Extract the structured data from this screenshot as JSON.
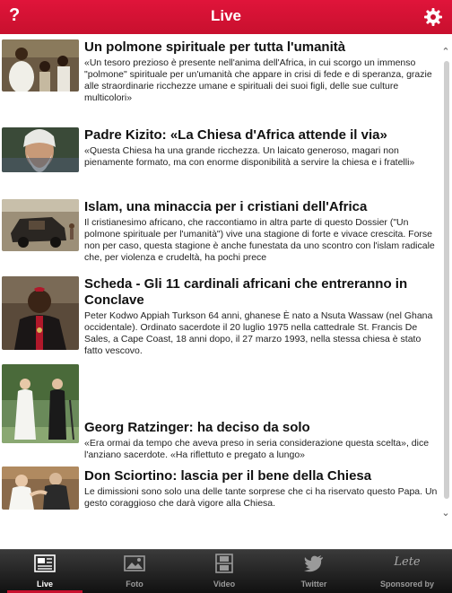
{
  "header": {
    "title": "Live",
    "help_label": "?"
  },
  "articles": [
    {
      "title": "Un polmone spirituale per tutta l'umanità",
      "summary": "«Un tesoro prezioso è presente nell'anima dell'Africa, in cui scorgo un immenso \"polmone\" spirituale per un'umanità che appare in crisi di fede e di speranza, grazie alle straordinarie ricchezze umane e spirituali dei suoi figli, delle sue culture multicolori»",
      "image": "missionary-with-children-photo"
    },
    {
      "title": "Padre Kizito: «La Chiesa d'Africa attende il via»",
      "summary": "«Questa Chiesa ha una grande ricchezza. Un laicato generoso, magari non pienamente formato, ma con enorme disponibilità a servire la chiesa e i fratelli»",
      "image": "bearded-priest-portrait-photo"
    },
    {
      "title": "Islam, una minaccia per i cristiani dell'Africa",
      "summary": "Il cristianesimo africano, che raccontiamo in altra parte di questo Dossier (\"Un polmone spirituale per l'umanità\") vive una stagione di forte e vivace crescita. Forse non per caso, questa stagione è anche funestata da uno scontro con l'islam radicale che, per violenza e crudeltà, ha pochi prece",
      "image": "burned-vehicle-photo"
    },
    {
      "title": "Scheda - Gli 11 cardinali africani che entreranno in Conclave",
      "summary": "Peter Kodwo Appiah Turkson 64 anni, ghanese È nato a Nsuta Wassaw (nel Ghana occidentale). Ordinato sacerdote il 20 luglio 1975 nella cattedrale St. Francis De Sales, a Cape Coast, 18 anni dopo, il 27 marzo 1993, nella stessa chiesa è stato fatto vescovo.",
      "image": "cardinal-portrait-photo"
    },
    {
      "title": "Georg Ratzinger: ha deciso da solo",
      "summary": "«Era ormai da tempo che aveva preso in seria considerazione questa scelta», dice l'anziano sacerdote. «Ha riflettuto e pregato a lungo»",
      "image": "pope-and-brother-walking-photo"
    },
    {
      "title": "Don Sciortino: lascia per il bene della Chiesa",
      "summary": "Le dimissioni sono solo una delle tante sorprese che ci ha riservato questo Papa. Un gesto coraggioso che darà vigore alla Chiesa.",
      "image": "pope-greeting-photo"
    }
  ],
  "tabs": [
    {
      "label": "Live",
      "icon": "newspaper-icon",
      "active": true
    },
    {
      "label": "Foto",
      "icon": "photo-icon",
      "active": false
    },
    {
      "label": "Video",
      "icon": "film-icon",
      "active": false
    },
    {
      "label": "Twitter",
      "icon": "twitter-bird-icon",
      "active": false
    },
    {
      "label": "Sponsored by",
      "logo_text": "Lete",
      "active": false
    }
  ],
  "colors": {
    "header_red": "#c8102e",
    "tabbar_dark": "#1a1a1a"
  }
}
